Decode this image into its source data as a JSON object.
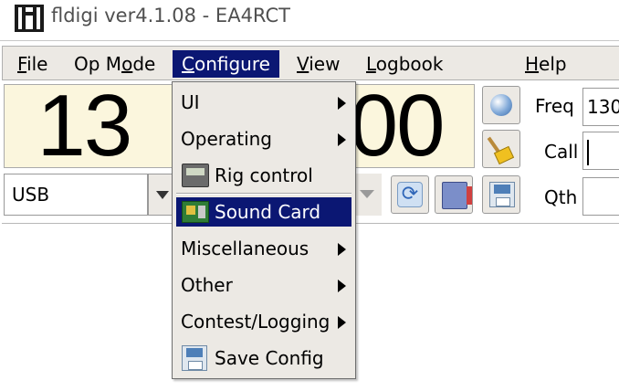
{
  "window": {
    "title": "fldigi ver4.1.08 - EA4RCT"
  },
  "menubar": {
    "items": [
      {
        "pre": "",
        "u": "F",
        "post": "ile"
      },
      {
        "pre": "Op M",
        "u": "o",
        "post": "de"
      },
      {
        "pre": "",
        "u": "C",
        "post": "onfigure"
      },
      {
        "pre": "",
        "u": "V",
        "post": "iew"
      },
      {
        "pre": "",
        "u": "L",
        "post": "ogbook"
      },
      {
        "pre": "",
        "u": "H",
        "post": "elp"
      }
    ],
    "active": "Configure"
  },
  "frequency": {
    "left_digits": "13",
    "right_digits": "000"
  },
  "rig": {
    "mode": "USB"
  },
  "log_fields": {
    "freq_label": "Freq",
    "freq_value": "130",
    "call_label": "Call",
    "call_value": "",
    "qth_label": "Qth",
    "qth_value": ""
  },
  "configure_menu": {
    "items": [
      {
        "label": "UI",
        "submenu": true,
        "icon": "none"
      },
      {
        "label": "Operating",
        "submenu": true,
        "icon": "none"
      },
      {
        "label": "Rig control",
        "submenu": false,
        "icon": "rig-control-icon"
      },
      {
        "label": "Sound Card",
        "submenu": false,
        "icon": "sound-card-icon",
        "highlighted": true
      },
      {
        "label": "Miscellaneous",
        "submenu": true,
        "icon": "none"
      },
      {
        "label": "Other",
        "submenu": true,
        "icon": "none"
      },
      {
        "label": "Contest/Logging",
        "submenu": true,
        "icon": "none"
      },
      {
        "label": "Save Config",
        "submenu": false,
        "icon": "save-config-icon"
      }
    ]
  },
  "colors": {
    "menu_highlight": "#0b1773",
    "freq_background": "#fbf6dd",
    "menu_background": "#ece9e4"
  },
  "icons": [
    "globe-icon",
    "broom-icon",
    "refresh-icon",
    "logbook-icon",
    "save-icon",
    "rig-control-icon",
    "sound-card-icon",
    "save-config-icon"
  ]
}
